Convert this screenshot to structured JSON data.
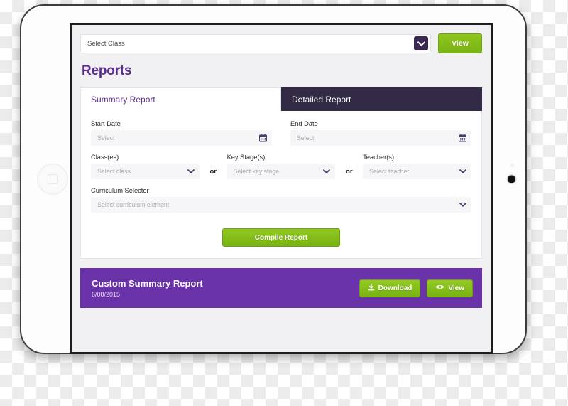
{
  "topbar": {
    "class_select_placeholder": "Select Class",
    "class_select_value": "",
    "dropdown_icon": "chevron-down-icon",
    "view_button_label": "View"
  },
  "page_title": "Reports",
  "tabs": [
    {
      "label": "Summary Report",
      "active": true
    },
    {
      "label": "Detailed Report",
      "active": false
    }
  ],
  "form": {
    "start_date": {
      "label": "Start Date",
      "placeholder": "Select",
      "value": "",
      "icon": "calendar-icon"
    },
    "end_date": {
      "label": "End Date",
      "placeholder": "Select",
      "value": "",
      "icon": "calendar-icon"
    },
    "classes": {
      "label": "Class(es)",
      "placeholder": "Select class",
      "value": "",
      "icon": "chevron-down-icon"
    },
    "separator_1": "or",
    "key_stages": {
      "label": "Key Stage(s)",
      "placeholder": "Select key stage",
      "value": "",
      "icon": "chevron-down-icon"
    },
    "separator_2": "or",
    "teachers": {
      "label": "Teacher(s)",
      "placeholder": "Select teacher",
      "value": "",
      "icon": "chevron-down-icon"
    },
    "curriculum": {
      "label": "Curriculum Selector",
      "placeholder": "Select curriculum element",
      "value": "",
      "icon": "chevron-down-icon"
    },
    "compile_button_label": "Compile Report"
  },
  "report_banner": {
    "title": "Custom Summary Report",
    "date": "6/08/2015",
    "download_label": "Download",
    "download_icon": "download-icon",
    "view_label": "View",
    "view_icon": "eye-icon"
  },
  "colors": {
    "brand_purple": "#5b2d8e",
    "banner_purple": "#6a32a8",
    "tab_dark": "#332a46",
    "accent_green": "#8fc61e",
    "screen_bg": "#f1f1f3"
  }
}
